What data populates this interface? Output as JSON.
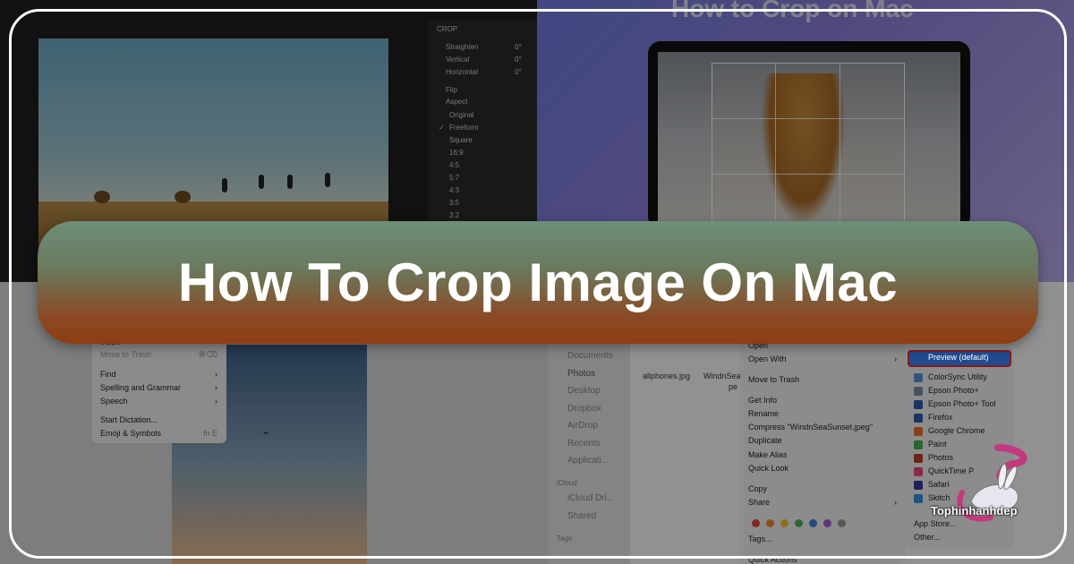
{
  "banner": {
    "title": "How To Crop Image On Mac"
  },
  "top_right": {
    "heading": "How to Crop on Mac"
  },
  "crop_panel": {
    "header": "CROP",
    "straighten": {
      "label": "Straighten",
      "value": "0°"
    },
    "vertical": {
      "label": "Vertical",
      "value": "0°"
    },
    "horizontal": {
      "label": "Horizontal",
      "value": "0°"
    },
    "flip": "Flip",
    "aspect": "Aspect",
    "ratios": [
      "Original",
      "Freeform",
      "Square",
      "16:9",
      "4:5",
      "5:7",
      "4:3",
      "3:5",
      "3:2"
    ]
  },
  "edit_menu": {
    "items": [
      "Insert",
      "Move to Trash",
      "Find",
      "Spelling and Grammar",
      "Speech",
      "Start Dictation...",
      "Emoji & Symbols"
    ],
    "shortcuts": {
      "trash": "⌘⌫",
      "emoji": "fn E"
    }
  },
  "finder": {
    "sidebar": [
      "Documents",
      "Photos",
      "Desktop",
      "Dropbox",
      "AirDrop",
      "Recents",
      "Applicati...",
      "iCloud",
      "iCloud Dri...",
      "Shared",
      "Tags"
    ],
    "files": [
      "allphones.jpg",
      "WindnSea",
      "pe"
    ]
  },
  "context_menu": {
    "items": [
      "Open",
      "Open With",
      "Move to Trash",
      "Get Info",
      "Rename",
      "Compress \"WindnSeaSunset.jpeg\"",
      "Duplicate",
      "Make Alias",
      "Quick Look",
      "Copy",
      "Share",
      "Tags...",
      "Quick Actions"
    ],
    "tag_colors": [
      "#e0443c",
      "#f08a2c",
      "#f2c230",
      "#4cb05a",
      "#3f7fe0",
      "#a35fd0",
      "#9a9a9a"
    ]
  },
  "open_with": {
    "items": [
      "Preview (default)",
      "ColorSync Utility",
      "Epson Photo+",
      "Epson Photo+ Tool",
      "Firefox",
      "Google Chrome",
      "Paint",
      "Photos",
      "QuickTime P",
      "Safari",
      "Skitch",
      "App Store...",
      "Other..."
    ],
    "icon_colors": [
      "#5b8fd9",
      "#7a8da0",
      "#2d5aa8",
      "#2d5aa8",
      "#e8702a",
      "#4caf50",
      "#c0392b",
      "#e84b8a",
      "#3a3a9a",
      "#2f8fe0",
      "#d6336c"
    ]
  },
  "watermark": {
    "text": "Tophinhanhdep"
  }
}
